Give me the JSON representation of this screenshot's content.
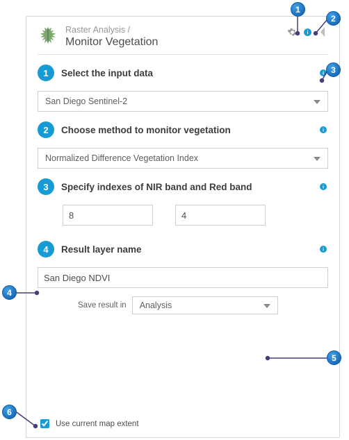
{
  "header": {
    "breadcrumb": "Raster Analysis /",
    "title": "Monitor Vegetation"
  },
  "sections": {
    "s1": {
      "num": "1",
      "title": "Select the input data",
      "select_value": "San Diego Sentinel-2"
    },
    "s2": {
      "num": "2",
      "title": "Choose method to monitor vegetation",
      "select_value": "Normalized Difference Vegetation Index"
    },
    "s3": {
      "num": "3",
      "title": "Specify indexes of NIR band and Red band",
      "nir": "8",
      "red": "4"
    },
    "s4": {
      "num": "4",
      "title": "Result layer name",
      "value": "San Diego NDVI",
      "save_in_label": "Save result in",
      "save_in_value": "Analysis"
    }
  },
  "footer": {
    "use_extent_label": "Use current map extent",
    "use_extent_checked": true
  },
  "callouts": {
    "c1": "1",
    "c2": "2",
    "c3": "3",
    "c4": "4",
    "c5": "5",
    "c6": "6"
  }
}
